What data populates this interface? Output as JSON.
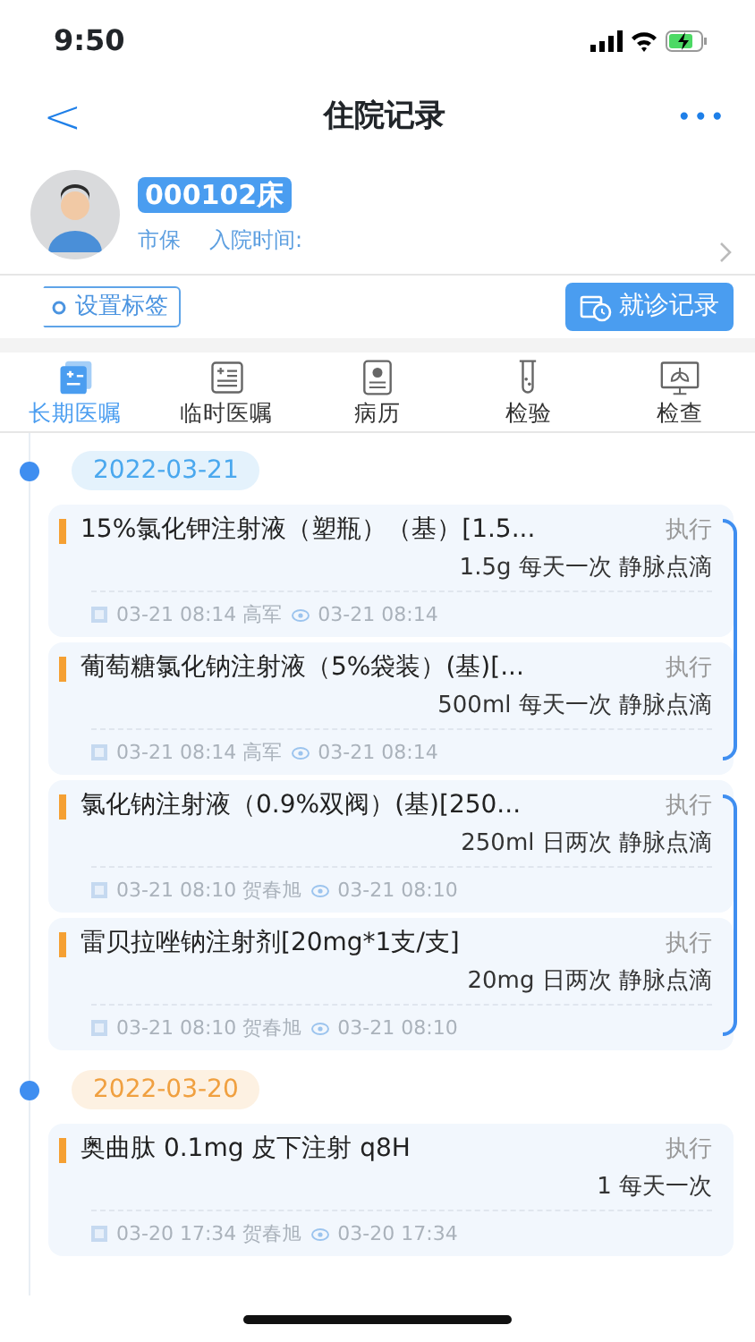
{
  "status_bar": {
    "time": "9:50"
  },
  "nav": {
    "back": "<",
    "title": "住院记录",
    "more": "•••"
  },
  "patient": {
    "bed": "000102床",
    "insurance": "市保",
    "admission_label": "入院时间:"
  },
  "actions": {
    "tag_button": "设置标签",
    "record_button": "就诊记录"
  },
  "tabs": [
    {
      "label": "长期医嘱",
      "selected": true
    },
    {
      "label": "临时医嘱",
      "selected": false
    },
    {
      "label": "病历",
      "selected": false
    },
    {
      "label": "检验",
      "selected": false
    },
    {
      "label": "检查",
      "selected": false
    }
  ],
  "dates": [
    {
      "date": "2022-03-21",
      "color": "#4aa8ee",
      "bundles": [
        {
          "linked": true,
          "orders": [
            {
              "name": "15%氯化钾注射液（塑瓶）（基）[1.5...",
              "status": "执行",
              "dosage": "1.5g 每天一次 静脉点滴",
              "created": "03-21 08:14 高军",
              "reviewed": "03-21 08:14"
            },
            {
              "name": "葡萄糖氯化钠注射液（5%袋装）(基)[...",
              "status": "执行",
              "dosage": "500ml 每天一次 静脉点滴",
              "created": "03-21 08:14 高军",
              "reviewed": "03-21 08:14"
            }
          ]
        },
        {
          "linked": true,
          "orders": [
            {
              "name": "氯化钠注射液（0.9%双阀）(基)[250...",
              "status": "执行",
              "dosage": "250ml 日两次 静脉点滴",
              "created": "03-21 08:10 贺春旭",
              "reviewed": "03-21 08:10"
            },
            {
              "name": "雷贝拉唑钠注射剂[20mg*1支/支]",
              "status": "执行",
              "dosage": "20mg 日两次 静脉点滴",
              "created": "03-21 08:10 贺春旭",
              "reviewed": "03-21 08:10"
            }
          ]
        }
      ]
    },
    {
      "date": "2022-03-20",
      "color": "#f0a040",
      "bundles": [
        {
          "linked": false,
          "orders": [
            {
              "name": "奥曲肽 0.1mg 皮下注射 q8H",
              "status": "执行",
              "dosage": "1 每天一次",
              "created": "03-20 17:34 贺春旭",
              "reviewed": "03-20 17:34"
            }
          ]
        }
      ]
    }
  ]
}
